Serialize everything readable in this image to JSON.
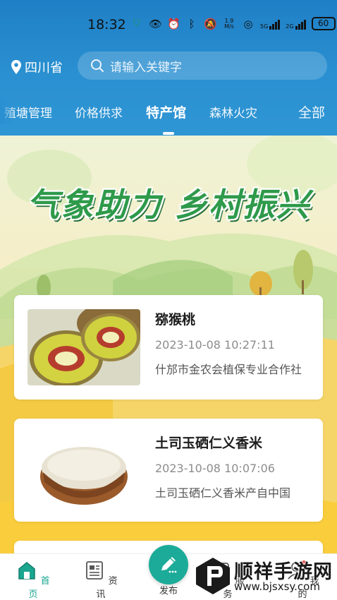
{
  "status_bar": {
    "time": "18:32",
    "net_speed_value": "1.9",
    "net_speed_unit": "M/s",
    "sim1": "5G",
    "sim2": "2G",
    "battery": "60"
  },
  "header": {
    "location": "四川省",
    "search": {
      "placeholder": "请输入关键字"
    },
    "tabs": [
      {
        "label": "殖塘管理"
      },
      {
        "label": "价格供求"
      },
      {
        "label": "特产馆",
        "active": true
      },
      {
        "label": "森林火灾"
      },
      {
        "label": "全部"
      }
    ]
  },
  "banner": {
    "title": "气象助力 乡村振兴"
  },
  "items": [
    {
      "title": "猕猴桃",
      "date": "2023-10-08 10:27:11",
      "desc": "什邡市金农会植保专业合作社",
      "image": "kiwi-image"
    },
    {
      "title": "土司玉硒仁义香米",
      "date": "2023-10-08 10:07:06",
      "desc": "土司玉硒仁义香米产自中国",
      "image": "rice-image"
    }
  ],
  "bottom_nav": [
    {
      "label": "首页",
      "icon": "home-icon",
      "active": true
    },
    {
      "label": "资讯",
      "icon": "news-icon"
    },
    {
      "label": "发布",
      "icon": "pen-icon"
    },
    {
      "label": "服务",
      "icon": "service-icon"
    },
    {
      "label": "我的",
      "icon": "user-icon"
    }
  ],
  "watermark": {
    "text": "顺祥手游网",
    "url": "www.bjsxsy.com"
  },
  "colors": {
    "header_blue": "#2a90d1",
    "accent_teal": "#1aa68f",
    "banner_green": "#2e9a4a"
  }
}
